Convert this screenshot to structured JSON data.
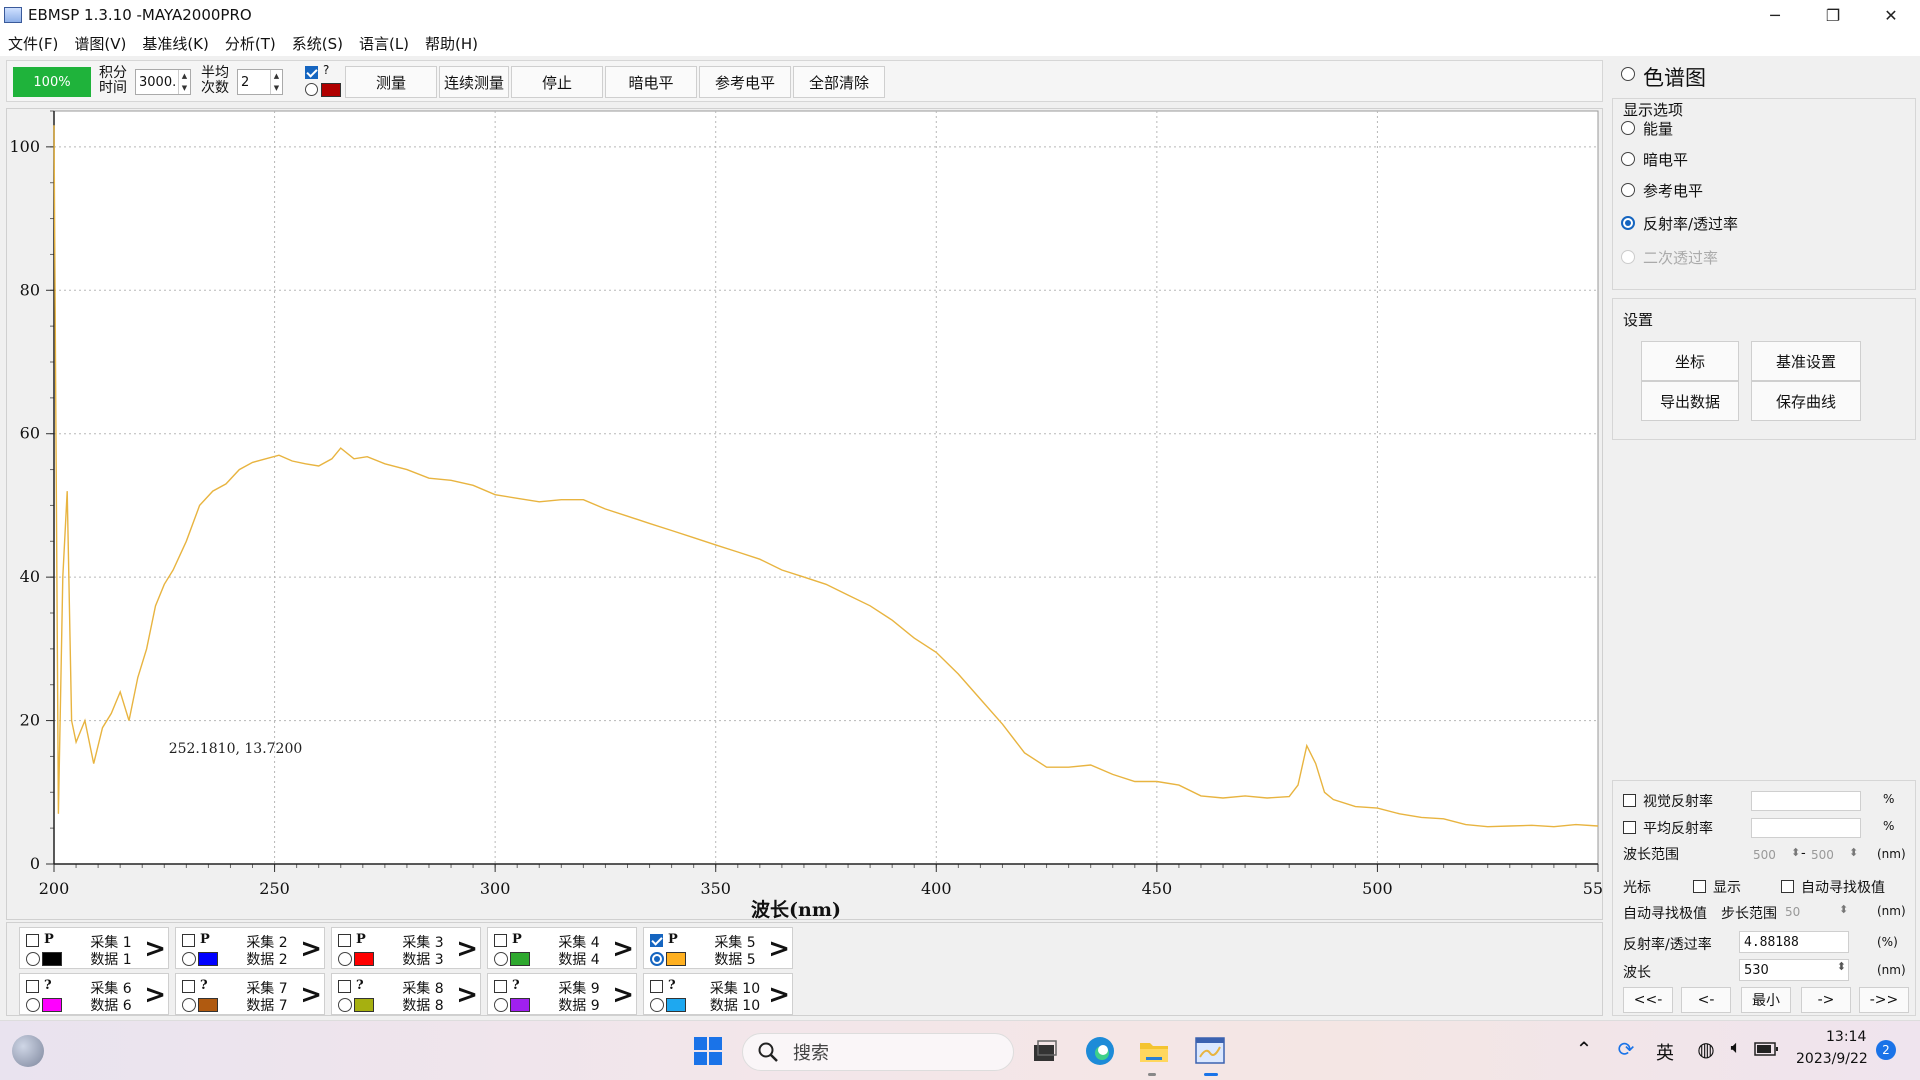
{
  "window": {
    "title": "EBMSP 1.3.10 -MAYA2000PRO",
    "controls": [
      "─",
      "❐",
      "✕"
    ]
  },
  "menu": [
    "文件(F)",
    "谱图(V)",
    "基准线(K)",
    "分析(T)",
    "系统(S)",
    "语言(L)",
    "帮助(H)"
  ],
  "toolbar": {
    "progress": "100%",
    "integration_label_1": "积分",
    "integration_label_2": "时间",
    "integration_value": "3000.",
    "average_label_1": "半均",
    "average_label_2": "次数",
    "average_value": "2",
    "question": "?",
    "buttons": [
      "测量",
      "连续测量",
      "停止",
      "暗电平",
      "参考电平",
      "全部清除"
    ]
  },
  "chart_data": {
    "type": "line",
    "title": "",
    "xlabel": "波长(nm)",
    "ylabel": "",
    "xlim": [
      200,
      550
    ],
    "ylim": [
      0,
      105
    ],
    "xticks": [
      200,
      250,
      300,
      350,
      400,
      450,
      500,
      550
    ],
    "yticks": [
      0,
      20,
      40,
      60,
      80,
      100
    ],
    "grid": true,
    "cursor_readout": "252.1810,  13.7200",
    "series": [
      {
        "color": "#e8b440",
        "x": [
          200,
          201,
          202,
          203,
          204,
          205,
          207,
          209,
          211,
          213,
          215,
          217,
          219,
          221,
          223,
          225,
          227,
          230,
          233,
          236,
          239,
          242,
          245,
          248,
          251,
          254,
          257,
          260,
          263,
          265,
          268,
          271,
          275,
          280,
          285,
          290,
          295,
          300,
          305,
          310,
          315,
          320,
          325,
          330,
          335,
          340,
          345,
          350,
          355,
          360,
          365,
          370,
          375,
          380,
          385,
          390,
          395,
          400,
          405,
          410,
          415,
          420,
          425,
          430,
          435,
          440,
          445,
          450,
          455,
          460,
          465,
          470,
          475,
          480,
          482,
          484,
          486,
          488,
          490,
          495,
          500,
          505,
          510,
          515,
          520,
          525,
          530,
          535,
          540,
          545,
          550
        ],
        "y": [
          103,
          7,
          40,
          52,
          20,
          17,
          20,
          14,
          19,
          21,
          24,
          20,
          26,
          30,
          36,
          39,
          41,
          45,
          50,
          52,
          53,
          55,
          56,
          56.5,
          57,
          56.2,
          55.8,
          55.5,
          56.5,
          58,
          56.5,
          56.8,
          55.8,
          55,
          53.8,
          53.5,
          52.8,
          51.5,
          51,
          50.5,
          50.8,
          50.8,
          49.5,
          48.5,
          47.5,
          46.5,
          45.5,
          44.5,
          43.5,
          42.5,
          41,
          40,
          39,
          37.5,
          36,
          34,
          31.5,
          29.5,
          26.5,
          23,
          19.5,
          15.5,
          13.5,
          13.5,
          13.8,
          12.5,
          11.5,
          11.5,
          11,
          9.5,
          9.2,
          9.5,
          9.2,
          9.4,
          11,
          16.5,
          14,
          10,
          9,
          8,
          7.8,
          7,
          6.5,
          6.3,
          5.5,
          5.2,
          5.3,
          5.4,
          5.2,
          5.5,
          5.3
        ]
      }
    ]
  },
  "series_panel": [
    {
      "flag": "P",
      "name": "采集 1",
      "data": "数据 1",
      "color": "#000000",
      "checked": false,
      "selected": false
    },
    {
      "flag": "P",
      "name": "采集 2",
      "data": "数据 2",
      "color": "#0000ff",
      "checked": false,
      "selected": false
    },
    {
      "flag": "P",
      "name": "采集 3",
      "data": "数据 3",
      "color": "#ff0000",
      "checked": false,
      "selected": false
    },
    {
      "flag": "P",
      "name": "采集 4",
      "data": "数据 4",
      "color": "#2ea82e",
      "checked": false,
      "selected": false
    },
    {
      "flag": "P",
      "name": "采集 5",
      "data": "数据 5",
      "color": "#ffb020",
      "checked": true,
      "selected": true
    },
    {
      "flag": "?",
      "name": "采集 6",
      "data": "数据 6",
      "color": "#ff00ff",
      "checked": false,
      "selected": false
    },
    {
      "flag": "?",
      "name": "采集 7",
      "data": "数据 7",
      "color": "#b05a10",
      "checked": false,
      "selected": false
    },
    {
      "flag": "?",
      "name": "采集 8",
      "data": "数据 8",
      "color": "#a6b010",
      "checked": false,
      "selected": false
    },
    {
      "flag": "?",
      "name": "采集 9",
      "data": "数据 9",
      "color": "#a020f0",
      "checked": false,
      "selected": false
    },
    {
      "flag": "?",
      "name": "采集 10",
      "data": "数据 10",
      "color": "#1ea8f0",
      "checked": false,
      "selected": false
    }
  ],
  "right_panel": {
    "spectrum_option": "色谱图",
    "display_title": "显示选项",
    "display_options": [
      "能量",
      "暗电平",
      "参考电平",
      "反射率/透过率",
      "二次透过率"
    ],
    "settings_title": "设置",
    "settings_buttons": [
      "坐标",
      "基准设置",
      "导出数据",
      "保存曲线"
    ],
    "visual_reflectance": "视觉反射率",
    "average_reflectance": "平均反射率",
    "percent": "%",
    "wavelength_range": "波长范围",
    "range_from": "500",
    "range_to": "500",
    "range_sep": "-",
    "nm_unit": "(nm)",
    "cursor_label": "光标",
    "show_label": "显示",
    "auto_peak_label": "自动寻找极值",
    "auto_peak_value_label": "自动寻找极值",
    "step_range_label": "步长范围",
    "step_value": "50",
    "reflectance_label": "反射率/透过率",
    "reflectance_value": "4.88188",
    "pct_unit": "(%)",
    "wavelength_label": "波长",
    "wavelength_value": "530",
    "nav_buttons": [
      "<<-",
      "<-",
      "最小",
      "->",
      "->>"
    ]
  },
  "taskbar": {
    "search_placeholder": "搜索",
    "ime": "英",
    "time": "13:14",
    "date": "2023/9/22",
    "notifications": "2"
  }
}
